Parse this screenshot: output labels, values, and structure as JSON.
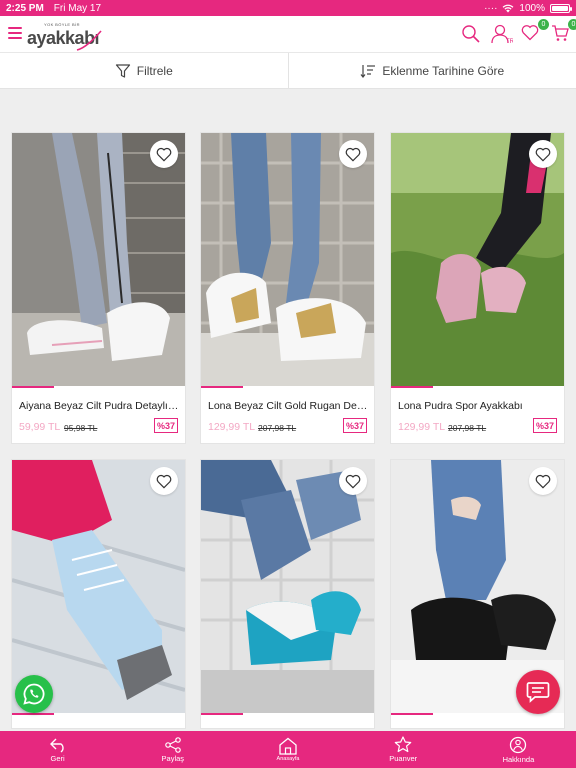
{
  "status_bar": {
    "time": "2:25 PM",
    "date": "Fri May 17",
    "battery": "100%"
  },
  "header": {
    "logo_tagline": "YOK BÖYLE BİR",
    "logo_brand": "ayakkabı",
    "favorites_count": "0",
    "cart_count": "0"
  },
  "toolbar": {
    "filter_label": "Filtrele",
    "sort_label": "Eklenme Tarihine Göre"
  },
  "products": [
    {
      "name": "Aiyana Beyaz Cilt Pudra Detaylı S...",
      "price": "59,99 TL",
      "old_price": "95,98 TL",
      "discount": "%37"
    },
    {
      "name": "Lona Beyaz Cilt Gold Rugan Deta...",
      "price": "129,99 TL",
      "old_price": "207,98 TL",
      "discount": "%37"
    },
    {
      "name": "Lona Pudra Spor Ayakkabı",
      "price": "129,99 TL",
      "old_price": "207,98 TL",
      "discount": "%37"
    },
    {
      "name": "",
      "price": "",
      "old_price": "",
      "discount": ""
    },
    {
      "name": "",
      "price": "",
      "old_price": "",
      "discount": ""
    },
    {
      "name": "",
      "price": "",
      "old_price": "",
      "discount": ""
    }
  ],
  "bottom_nav": [
    {
      "label": "Geri",
      "icon": "back-arrow-icon"
    },
    {
      "label": "Paylaş",
      "icon": "share-icon"
    },
    {
      "label": "Anasayfa",
      "icon": "home-icon"
    },
    {
      "label": "Puanver",
      "icon": "star-icon"
    },
    {
      "label": "Hakkında",
      "icon": "info-icon"
    }
  ],
  "colors": {
    "brand": "#e6287f",
    "badge": "#3cb34a",
    "whatsapp": "#27c04a",
    "chat": "#e62a55"
  }
}
